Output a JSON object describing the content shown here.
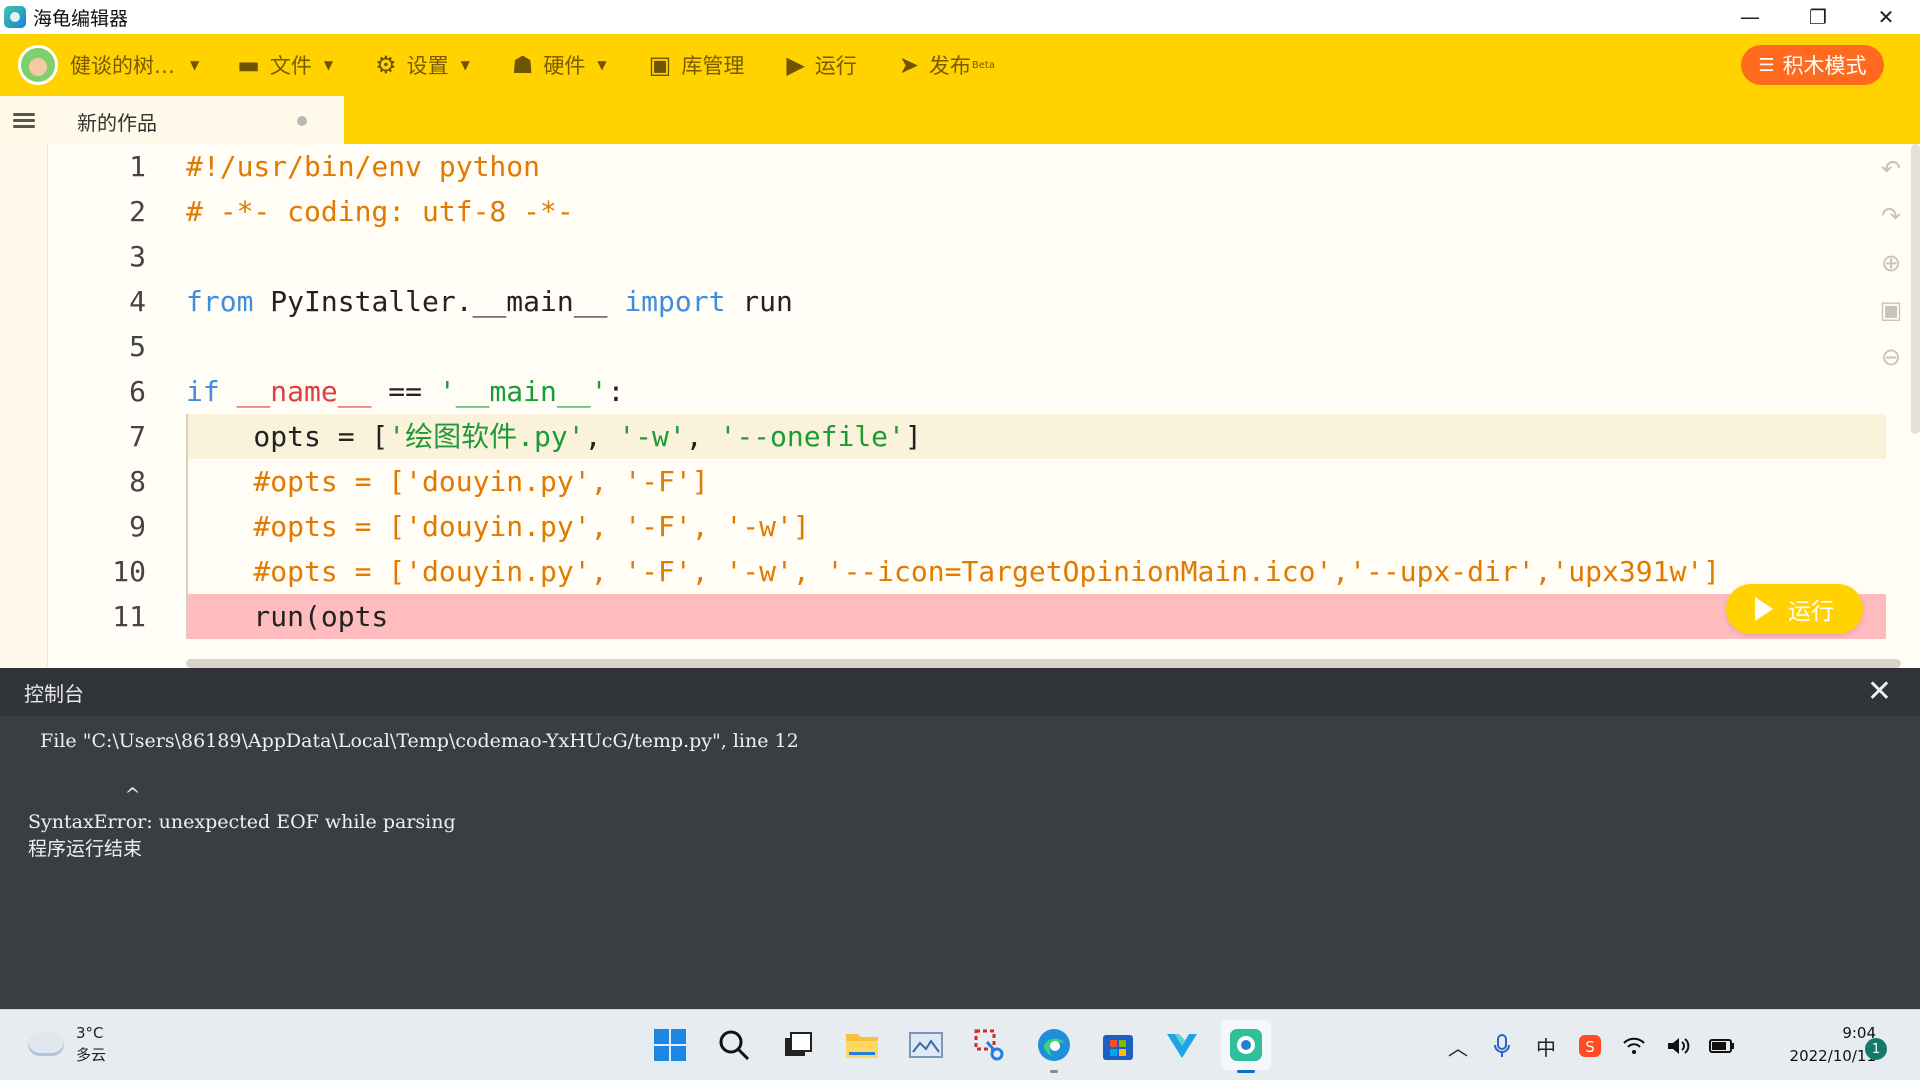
{
  "window": {
    "title": "海龟编辑器",
    "controls": {
      "minimize": "—",
      "restore": "❐",
      "close": "✕"
    }
  },
  "toolbar": {
    "user_name": "健谈的树…",
    "menu_file": "文件",
    "menu_settings": "设置",
    "menu_hardware": "硬件",
    "library": "库管理",
    "run": "运行",
    "publish": "发布",
    "publish_badge": "Beta",
    "block_mode": "积木模式",
    "accent_color": "#ffd200",
    "block_mode_color": "#ff6a1f"
  },
  "tabs": [
    {
      "label": "新的作品",
      "modified": true
    }
  ],
  "editor": {
    "line_numbers": [
      "1",
      "2",
      "3",
      "4",
      "5",
      "6",
      "7",
      "8",
      "9",
      "10",
      "11"
    ],
    "current_line": 7,
    "error_line": 11,
    "run_button": "运行",
    "lines": [
      [
        {
          "t": "#!/usr/bin/env python",
          "c": "cm"
        }
      ],
      [
        {
          "t": "# -*- coding: utf-8 -*-",
          "c": "cm"
        }
      ],
      [],
      [
        {
          "t": "from",
          "c": "kw"
        },
        {
          "t": " PyInstaller.__main__ ",
          "c": ""
        },
        {
          "t": "import",
          "c": "kw"
        },
        {
          "t": " run",
          "c": ""
        }
      ],
      [],
      [
        {
          "t": "if",
          "c": "kw"
        },
        {
          "t": " ",
          "c": ""
        },
        {
          "t": "__name__",
          "c": "dun"
        },
        {
          "t": " == ",
          "c": ""
        },
        {
          "t": "'__main__'",
          "c": "str"
        },
        {
          "t": ":",
          "c": ""
        }
      ],
      [
        {
          "t": "    opts = [",
          "c": ""
        },
        {
          "t": "'绘图软件.py'",
          "c": "str"
        },
        {
          "t": ", ",
          "c": ""
        },
        {
          "t": "'-w'",
          "c": "str"
        },
        {
          "t": ", ",
          "c": ""
        },
        {
          "t": "'--onefile'",
          "c": "str"
        },
        {
          "t": "]",
          "c": ""
        }
      ],
      [
        {
          "t": "    #opts = ['douyin.py', '-F']",
          "c": "cm"
        }
      ],
      [
        {
          "t": "    #opts = ['douyin.py', '-F', '-w']",
          "c": "cm"
        }
      ],
      [
        {
          "t": "    #opts = ['douyin.py', '-F', '-w', '--icon=TargetOpinionMain.ico','--upx-dir','upx391w']",
          "c": "cm"
        }
      ],
      [
        {
          "t": "    run(opts",
          "c": ""
        }
      ]
    ]
  },
  "console": {
    "title": "控制台",
    "lines": [
      "  File \"C:\\Users\\86189\\AppData\\Local\\Temp\\codemao-YxHUcG/temp.py\", line 12",
      "",
      "                ^",
      "SyntaxError: unexpected EOF while parsing",
      "程序运行结束"
    ]
  },
  "taskbar": {
    "weather_temp": "3°C",
    "weather_desc": "多云",
    "time": "9:04",
    "date": "2022/10/11",
    "notification_count": "1",
    "ime_label": "中"
  }
}
